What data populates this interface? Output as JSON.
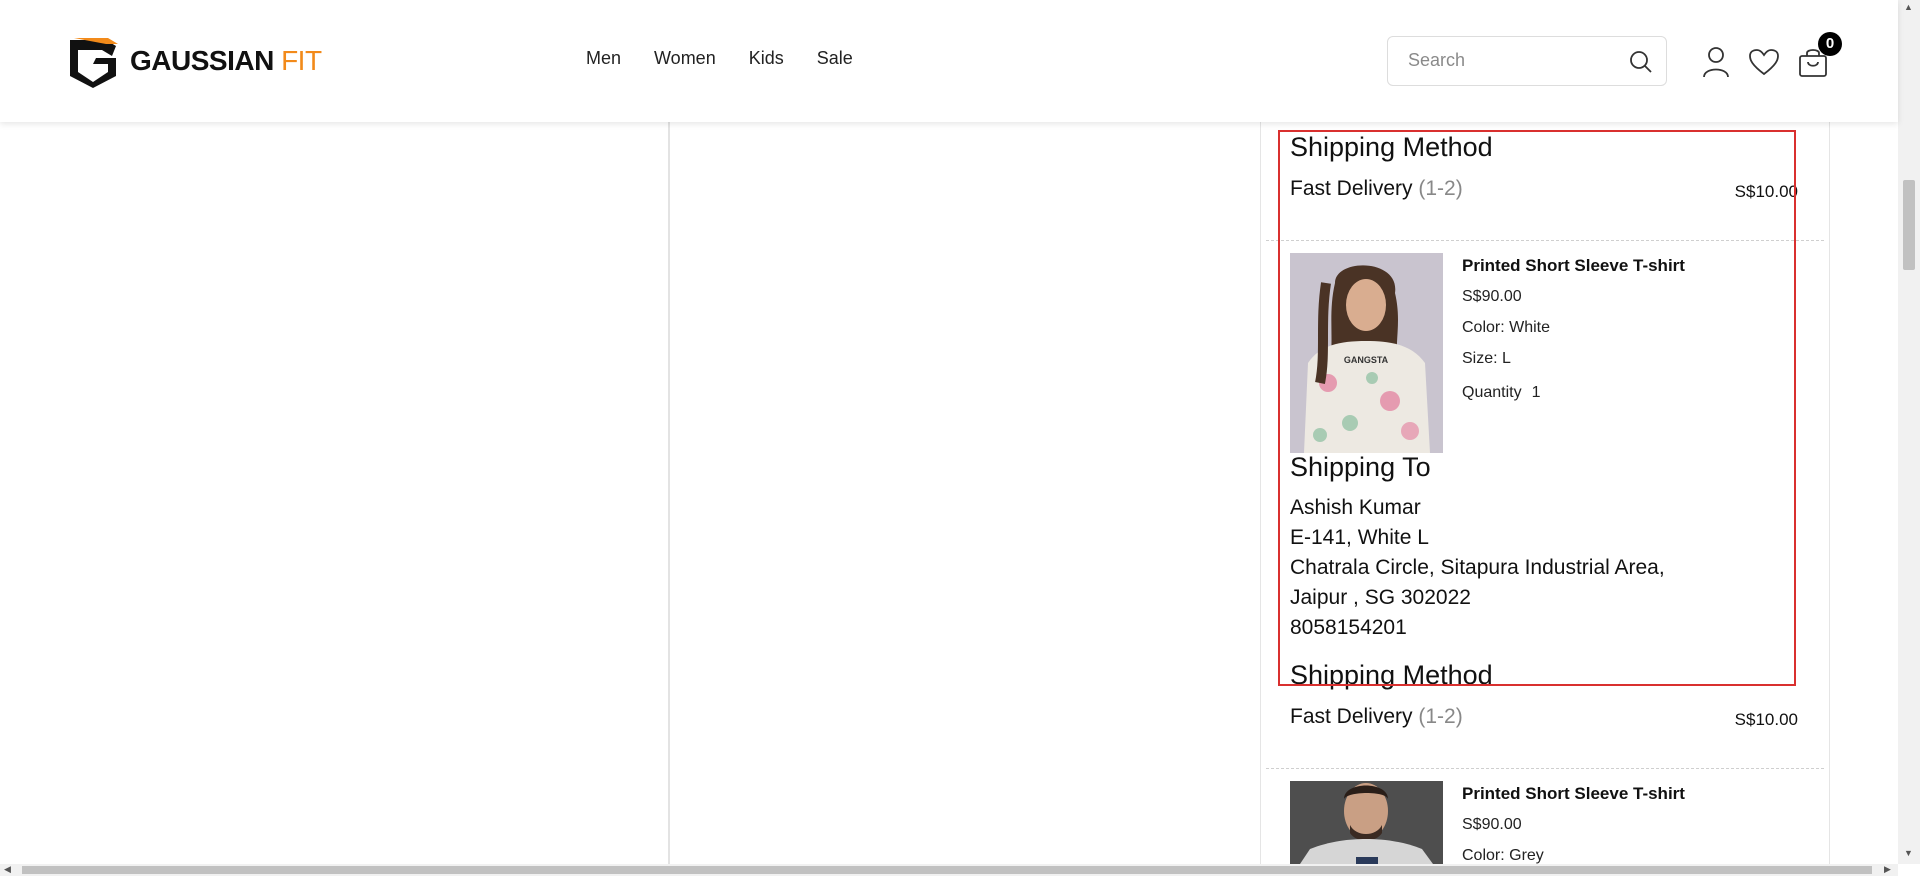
{
  "brand": {
    "name_main": "GAUSSIAN",
    "name_accent": "FIT",
    "accent_color": "#f28a1a"
  },
  "nav": {
    "items": [
      "Men",
      "Women",
      "Kids",
      "Sale"
    ]
  },
  "search": {
    "placeholder": "Search"
  },
  "header_icons": [
    "user-icon",
    "heart-icon",
    "shopping-bag-icon"
  ],
  "cart": {
    "count": "0"
  },
  "order": {
    "shipping_method_heading": "Shipping Method",
    "delivery_label": "Fast Delivery",
    "delivery_days": "(1-2)",
    "delivery_price": "S$10.00",
    "shipping_to_heading": "Shipping To",
    "items": [
      {
        "name": "Printed Short Sleeve T-shirt",
        "price": "S$90.00",
        "color": "Color: White",
        "size": "Size: L",
        "quantity_label": "Quantity",
        "quantity": "1",
        "print_text": "GANGSTA"
      },
      {
        "name": "Printed Short Sleeve T-shirt",
        "price": "S$90.00",
        "color": "Color: Grey"
      }
    ],
    "address": {
      "name": "Ashish Kumar",
      "line1": "E-141, White L",
      "line2": "Chatrala Circle, Sitapura Industrial Area,",
      "line3": "Jaipur , SG 302022",
      "phone": "8058154201"
    }
  },
  "colors": {
    "highlight": "#d9302f"
  }
}
